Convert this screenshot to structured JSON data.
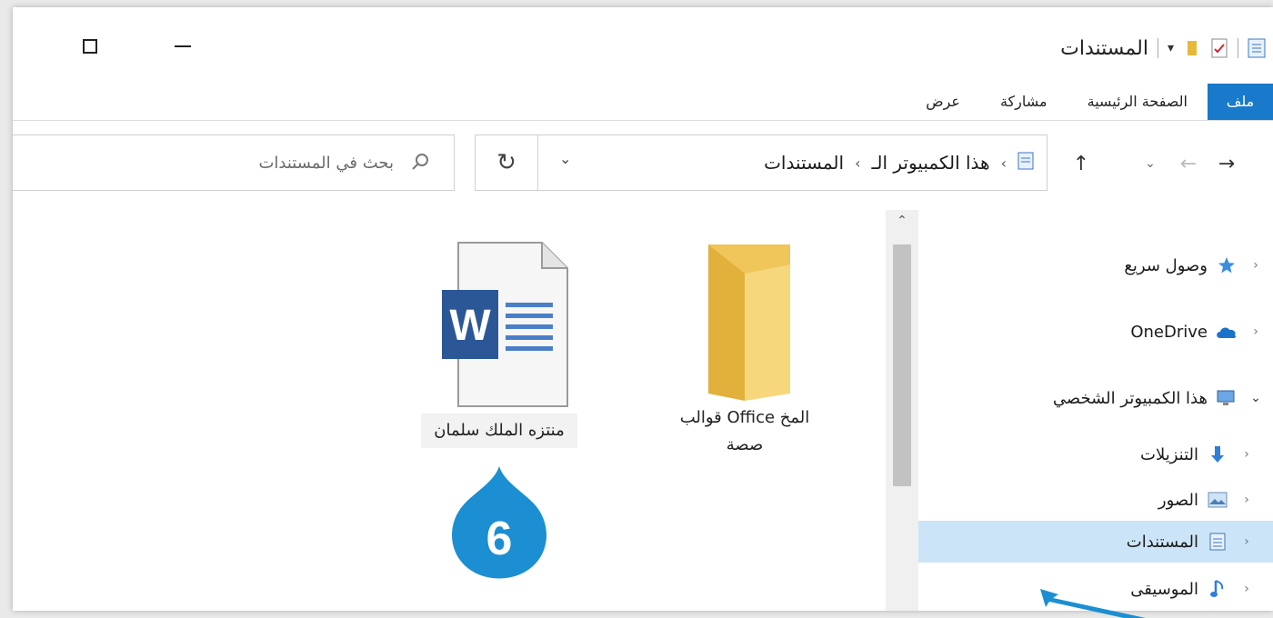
{
  "window": {
    "title": "المستندات",
    "minimize_label": "",
    "maximize_label": ""
  },
  "ribbon": {
    "tabs": [
      {
        "label": "ملف",
        "active": true
      },
      {
        "label": "الصفحة الرئيسية",
        "active": false
      },
      {
        "label": "مشاركة",
        "active": false
      },
      {
        "label": "عرض",
        "active": false
      }
    ]
  },
  "address_bar": {
    "breadcrumb": [
      "هذا الكمبيوتر الـ",
      "المستندات"
    ],
    "icon": "documents-icon"
  },
  "search": {
    "placeholder": "بحث في المستندات"
  },
  "files": [
    {
      "name": "قوالب Office المخ صصة",
      "line1": "قوالب Office المخ",
      "line2": "صصة",
      "icon": "folder-icon"
    },
    {
      "name": "منتزه الملك سلمان",
      "icon": "word-document-icon"
    }
  ],
  "callout": {
    "number": "6"
  },
  "nav_pane": {
    "items": [
      {
        "label": "وصول سريع",
        "icon": "star-icon",
        "expanded": false
      },
      {
        "label": "OneDrive",
        "icon": "cloud-icon",
        "expanded": false
      },
      {
        "label": "هذا الكمبيوتر الشخصي",
        "icon": "computer-icon",
        "expanded": true
      },
      {
        "label": "التنزيلات",
        "icon": "download-icon",
        "child": true
      },
      {
        "label": "الصور",
        "icon": "pictures-icon",
        "child": true
      },
      {
        "label": "المستندات",
        "icon": "documents-icon",
        "child": true,
        "selected": true
      },
      {
        "label": "الموسيقى",
        "icon": "music-icon",
        "child": true
      }
    ]
  },
  "colors": {
    "accent": "#1979ca",
    "selected": "#cce4f7",
    "callout": "#1b8fd1",
    "folder": "#f2cf67",
    "word": "#2b5797"
  }
}
